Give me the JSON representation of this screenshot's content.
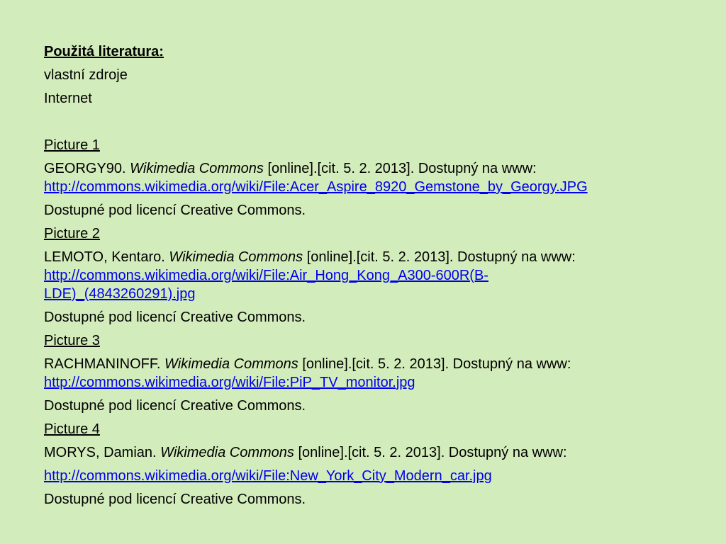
{
  "heading": "Použitá literatura:",
  "intro": [
    "vlastní zdroje",
    "Internet"
  ],
  "references": [
    {
      "label": "Picture 1",
      "author": "GEORGY90.",
      "source": "Wikimedia Commons",
      "rest": "[online].[cit. 5. 2. 2013]. Dostupný na www:",
      "url_lines": [
        "http://commons.wikimedia.org/wiki/File:Acer_Aspire_8920_Gemstone_by_Georgy.JPG"
      ],
      "license": "Dostupné pod licencí Creative Commons."
    },
    {
      "label": "Picture 2",
      "author": "LEMOTO, Kentaro.",
      "source": "Wikimedia Commons",
      "rest": "[online].[cit. 5. 2. 2013]. Dostupný na www:",
      "url_lines": [
        "http://commons.wikimedia.org/wiki/File:Air_Hong_Kong_A300-600R(B-",
        "LDE)_(4843260291).jpg"
      ],
      "license": "Dostupné pod licencí Creative Commons."
    },
    {
      "label": "Picture 3",
      "author": "RACHMANINOFF.",
      "source": "Wikimedia Commons",
      "rest": "[online].[cit. 5. 2. 2013]. Dostupný na www:",
      "url_lines": [
        "http://commons.wikimedia.org/wiki/File:PiP_TV_monitor.jpg"
      ],
      "license": "Dostupné pod licencí Creative Commons."
    },
    {
      "label": "Picture 4",
      "author": "MORYS, Damian.",
      "source": "Wikimedia Commons",
      "rest": "[online].[cit. 5. 2. 2013]. Dostupný na www:",
      "url_lines": [
        "http://commons.wikimedia.org/wiki/File:New_York_City_Modern_car.jpg"
      ],
      "license": "Dostupné pod licencí Creative Commons."
    }
  ]
}
